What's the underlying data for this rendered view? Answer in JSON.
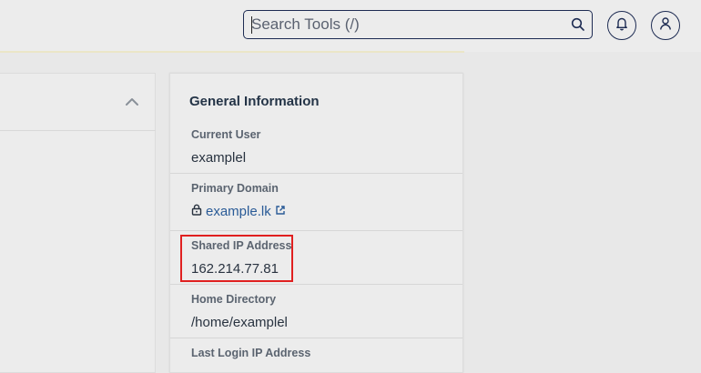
{
  "search": {
    "placeholder": "Search Tools (/)",
    "icon": "search-icon"
  },
  "header": {
    "notifications_icon": "bell-icon",
    "account_icon": "user-icon"
  },
  "info_panel": {
    "title": "General Information",
    "rows": [
      {
        "label": "Current User",
        "value": "examplel"
      },
      {
        "label": "Primary Domain",
        "value": "example.lk"
      },
      {
        "label": "Shared IP Address",
        "value": "162.214.77.81"
      },
      {
        "label": "Home Directory",
        "value": "/home/examplel"
      },
      {
        "label": "Last Login IP Address",
        "value": ""
      }
    ]
  },
  "colors": {
    "accent_border": "#1d2b52",
    "link": "#2a5b97",
    "highlight": "#e02020"
  }
}
